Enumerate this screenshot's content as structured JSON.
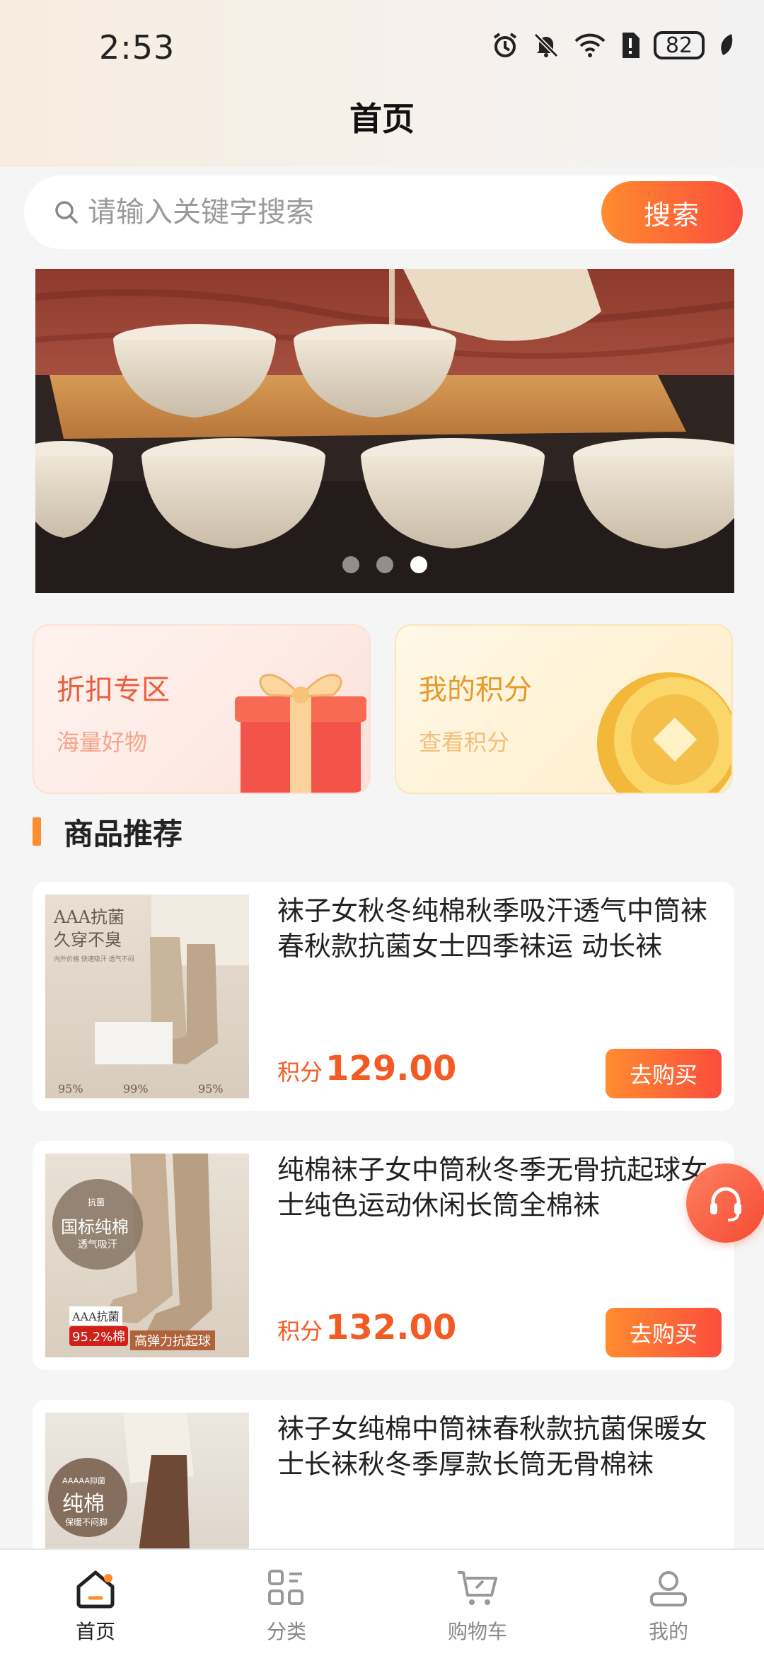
{
  "status_bar": {
    "time": "2:53",
    "battery": "82"
  },
  "header": {
    "title": "首页"
  },
  "search": {
    "placeholder": "请输入关键字搜索",
    "button_label": "搜索"
  },
  "banner": {
    "slide_count": 3,
    "active_index": 2
  },
  "cards": {
    "discount": {
      "title": "折扣专区",
      "subtitle": "海量好物"
    },
    "points": {
      "title": "我的积分",
      "subtitle": "查看积分"
    }
  },
  "section": {
    "title": "商品推荐"
  },
  "products": [
    {
      "name": "袜子女秋冬纯棉秋季吸汗透气中筒袜春秋款抗菌女士四季袜运 动长袜",
      "price_label": "积分",
      "price": "129.00",
      "buy_label": "去购买",
      "image_text": {
        "t1": "AAA抗菌",
        "t2": "久穿不臭",
        "t3": "内外价格 快速吸汗 透气不闷",
        "t4": "95%",
        "t5": "99%",
        "t6": "95%"
      }
    },
    {
      "name": "纯棉袜子女中筒秋冬季无骨抗起球女士纯色运动休闲长筒全棉袜",
      "price_label": "积分",
      "price": "132.00",
      "buy_label": "去购买",
      "image_text": {
        "t1": "抗菌",
        "t2": "国标纯棉",
        "t3": "透气吸汗",
        "t4": "AAA抗菌",
        "t5": "95.2%棉",
        "t6": "高弹力抗起球"
      }
    },
    {
      "name": "袜子女纯棉中筒袜春秋款抗菌保暖女士长袜秋冬季厚款长筒无骨棉袜",
      "image_text": {
        "t1": "AAAAA抑菌",
        "t2": "纯棉",
        "t3": "保暖不闷脚"
      }
    }
  ],
  "tabbar": {
    "items": [
      {
        "label": "首页",
        "icon": "home-icon",
        "active": true
      },
      {
        "label": "分类",
        "icon": "category-icon",
        "active": false
      },
      {
        "label": "购物车",
        "icon": "cart-icon",
        "active": false
      },
      {
        "label": "我的",
        "icon": "profile-icon",
        "active": false
      }
    ]
  },
  "colors": {
    "accent_start": "#ff8c2f",
    "accent_end": "#fb4d3d",
    "price": "#f35a24"
  }
}
